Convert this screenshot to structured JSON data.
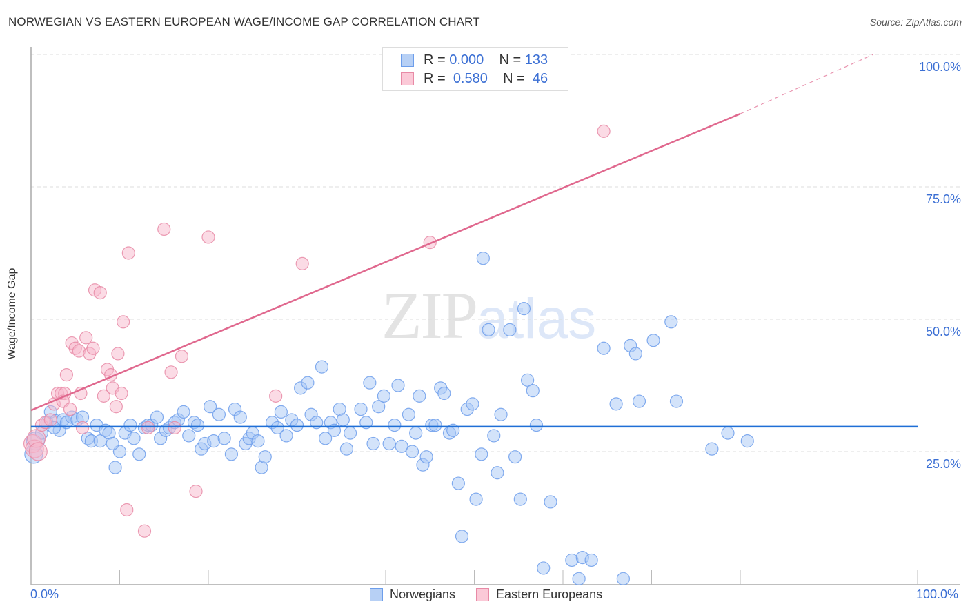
{
  "title": "NORWEGIAN VS EASTERN EUROPEAN WAGE/INCOME GAP CORRELATION CHART",
  "source": "Source: ZipAtlas.com",
  "watermark": {
    "zip": "ZIP",
    "atlas": "atlas"
  },
  "legend_top": [
    {
      "name": "Norwegians",
      "r_label": "R =",
      "r_value": "0.000",
      "n_label": "N =",
      "n_value": "133"
    },
    {
      "name": "Eastern Europeans",
      "r_label": "R =",
      "r_value": "0.580",
      "n_label": "N =",
      "n_value": "46"
    }
  ],
  "colors": {
    "blue": "#6d9eeb",
    "blue_fill": "#a8c7f5",
    "blue_line": "#1f6fd6",
    "pink": "#e88aa6",
    "pink_fill": "#f7b8cb",
    "pink_line": "#e0688e",
    "axis_text": "#3b6fd4"
  },
  "chart_data": {
    "type": "scatter",
    "title": "NORWEGIAN VS EASTERN EUROPEAN WAGE/INCOME GAP CORRELATION CHART",
    "xlabel": "",
    "ylabel": "Wage/Income Gap",
    "xlim": [
      0,
      100
    ],
    "ylim": [
      0,
      100
    ],
    "x_ticks": [
      "0.0%",
      "100.0%"
    ],
    "y_ticks": [
      "25.0%",
      "50.0%",
      "75.0%",
      "100.0%"
    ],
    "grid": true,
    "legend_position": "bottom-center",
    "series": [
      {
        "name": "Norwegians",
        "r": 0.0,
        "n": 133,
        "trendline": {
          "x": [
            0,
            100
          ],
          "y": [
            29.7,
            29.7
          ]
        },
        "points": [
          [
            0.3,
            24.5
          ],
          [
            0.5,
            27.0
          ],
          [
            1.2,
            28.5
          ],
          [
            1.8,
            30.5
          ],
          [
            2.2,
            32.5
          ],
          [
            2.8,
            30.8
          ],
          [
            3.2,
            29.0
          ],
          [
            3.6,
            31.0
          ],
          [
            4.0,
            30.5
          ],
          [
            4.6,
            31.5
          ],
          [
            5.2,
            31.0
          ],
          [
            5.8,
            31.5
          ],
          [
            6.4,
            27.5
          ],
          [
            6.8,
            27.0
          ],
          [
            7.4,
            30.0
          ],
          [
            7.8,
            27.0
          ],
          [
            8.4,
            29.0
          ],
          [
            8.8,
            28.5
          ],
          [
            9.5,
            22.0
          ],
          [
            10.0,
            25.0
          ],
          [
            10.6,
            28.5
          ],
          [
            11.2,
            30.0
          ],
          [
            11.6,
            27.5
          ],
          [
            12.2,
            24.5
          ],
          [
            12.8,
            29.5
          ],
          [
            13.2,
            30.0
          ],
          [
            13.6,
            30.0
          ],
          [
            14.2,
            31.5
          ],
          [
            14.6,
            27.5
          ],
          [
            15.2,
            29.0
          ],
          [
            15.6,
            29.5
          ],
          [
            16.2,
            30.5
          ],
          [
            16.6,
            31.0
          ],
          [
            17.2,
            32.5
          ],
          [
            17.8,
            28.0
          ],
          [
            18.4,
            30.5
          ],
          [
            18.8,
            30.0
          ],
          [
            19.2,
            25.5
          ],
          [
            19.6,
            26.5
          ],
          [
            20.2,
            33.5
          ],
          [
            20.6,
            27.0
          ],
          [
            21.2,
            32.0
          ],
          [
            21.8,
            27.5
          ],
          [
            22.6,
            24.5
          ],
          [
            23.0,
            33.0
          ],
          [
            23.6,
            31.5
          ],
          [
            24.2,
            26.5
          ],
          [
            24.6,
            27.5
          ],
          [
            25.0,
            28.5
          ],
          [
            25.6,
            27.0
          ],
          [
            26.0,
            22.0
          ],
          [
            26.4,
            24.0
          ],
          [
            27.2,
            30.5
          ],
          [
            27.8,
            29.5
          ],
          [
            28.2,
            32.5
          ],
          [
            28.8,
            28.0
          ],
          [
            29.4,
            31.0
          ],
          [
            30.0,
            30.0
          ],
          [
            30.4,
            37.0
          ],
          [
            31.2,
            38.0
          ],
          [
            31.6,
            32.0
          ],
          [
            32.2,
            30.5
          ],
          [
            32.8,
            41.0
          ],
          [
            33.2,
            27.5
          ],
          [
            33.8,
            30.5
          ],
          [
            34.2,
            29.0
          ],
          [
            34.8,
            33.0
          ],
          [
            35.2,
            31.0
          ],
          [
            35.6,
            25.5
          ],
          [
            36.0,
            28.5
          ],
          [
            37.2,
            33.0
          ],
          [
            37.8,
            30.5
          ],
          [
            38.2,
            38.0
          ],
          [
            38.6,
            26.5
          ],
          [
            39.2,
            33.5
          ],
          [
            39.8,
            35.5
          ],
          [
            40.4,
            26.5
          ],
          [
            41.0,
            30.0
          ],
          [
            41.4,
            37.5
          ],
          [
            41.8,
            26.0
          ],
          [
            42.6,
            32.0
          ],
          [
            43.0,
            25.0
          ],
          [
            43.4,
            28.5
          ],
          [
            43.8,
            35.5
          ],
          [
            44.2,
            22.5
          ],
          [
            44.6,
            24.0
          ],
          [
            45.2,
            30.0
          ],
          [
            45.6,
            30.0
          ],
          [
            46.2,
            37.0
          ],
          [
            46.6,
            36.0
          ],
          [
            47.2,
            28.5
          ],
          [
            47.6,
            29.0
          ],
          [
            48.2,
            19.0
          ],
          [
            48.6,
            9.0
          ],
          [
            49.2,
            33.0
          ],
          [
            49.8,
            34.0
          ],
          [
            50.2,
            16.0
          ],
          [
            50.8,
            24.5
          ],
          [
            51.0,
            61.5
          ],
          [
            51.6,
            48.0
          ],
          [
            52.2,
            28.0
          ],
          [
            52.6,
            21.0
          ],
          [
            53.0,
            32.0
          ],
          [
            54.0,
            48.0
          ],
          [
            54.6,
            24.0
          ],
          [
            55.2,
            16.0
          ],
          [
            55.6,
            52.0
          ],
          [
            56.0,
            38.5
          ],
          [
            56.6,
            36.5
          ],
          [
            57.0,
            30.0
          ],
          [
            57.8,
            3.0
          ],
          [
            58.6,
            15.5
          ],
          [
            61.0,
            4.5
          ],
          [
            61.8,
            1.0
          ],
          [
            62.2,
            5.0
          ],
          [
            63.2,
            4.5
          ],
          [
            64.6,
            44.5
          ],
          [
            66.0,
            34.0
          ],
          [
            66.8,
            1.0
          ],
          [
            67.6,
            45.0
          ],
          [
            68.2,
            43.5
          ],
          [
            68.6,
            34.5
          ],
          [
            70.2,
            46.0
          ],
          [
            72.2,
            49.5
          ],
          [
            72.8,
            34.5
          ],
          [
            76.8,
            25.5
          ],
          [
            78.6,
            28.5
          ],
          [
            80.8,
            27.0
          ],
          [
            2.6,
            29.5
          ],
          [
            9.2,
            26.5
          ]
        ]
      },
      {
        "name": "Eastern Europeans",
        "r": 0.58,
        "n": 46,
        "trendline": {
          "x": [
            0,
            80
          ],
          "y": [
            32.8,
            88.8
          ],
          "dashed_extension": {
            "x": [
              80,
              95
            ],
            "y": [
              88.8,
              100
            ]
          }
        },
        "points": [
          [
            0.2,
            26.5
          ],
          [
            0.4,
            25.5
          ],
          [
            0.6,
            27.5
          ],
          [
            1.2,
            30.0
          ],
          [
            1.6,
            30.5
          ],
          [
            2.2,
            31.0
          ],
          [
            2.6,
            34.0
          ],
          [
            3.0,
            36.0
          ],
          [
            3.4,
            36.0
          ],
          [
            3.8,
            36.0
          ],
          [
            3.6,
            34.5
          ],
          [
            4.0,
            39.5
          ],
          [
            4.4,
            33.0
          ],
          [
            4.6,
            45.5
          ],
          [
            5.0,
            44.5
          ],
          [
            5.4,
            44.0
          ],
          [
            5.6,
            36.0
          ],
          [
            5.8,
            29.5
          ],
          [
            6.2,
            46.5
          ],
          [
            6.6,
            43.5
          ],
          [
            7.0,
            44.5
          ],
          [
            7.2,
            55.5
          ],
          [
            7.8,
            55.0
          ],
          [
            8.2,
            35.5
          ],
          [
            8.6,
            40.5
          ],
          [
            9.0,
            39.5
          ],
          [
            9.2,
            37.0
          ],
          [
            9.6,
            33.5
          ],
          [
            9.8,
            43.5
          ],
          [
            10.2,
            36.0
          ],
          [
            10.4,
            49.5
          ],
          [
            10.8,
            14.0
          ],
          [
            11.0,
            62.5
          ],
          [
            12.8,
            10.0
          ],
          [
            13.2,
            29.5
          ],
          [
            15.0,
            67.0
          ],
          [
            15.8,
            40.0
          ],
          [
            16.2,
            29.5
          ],
          [
            17.0,
            43.0
          ],
          [
            18.6,
            17.5
          ],
          [
            20.0,
            65.5
          ],
          [
            27.6,
            35.5
          ],
          [
            30.6,
            60.5
          ],
          [
            45.0,
            64.5
          ],
          [
            64.6,
            85.5
          ],
          [
            0.8,
            25.0
          ]
        ]
      }
    ]
  }
}
